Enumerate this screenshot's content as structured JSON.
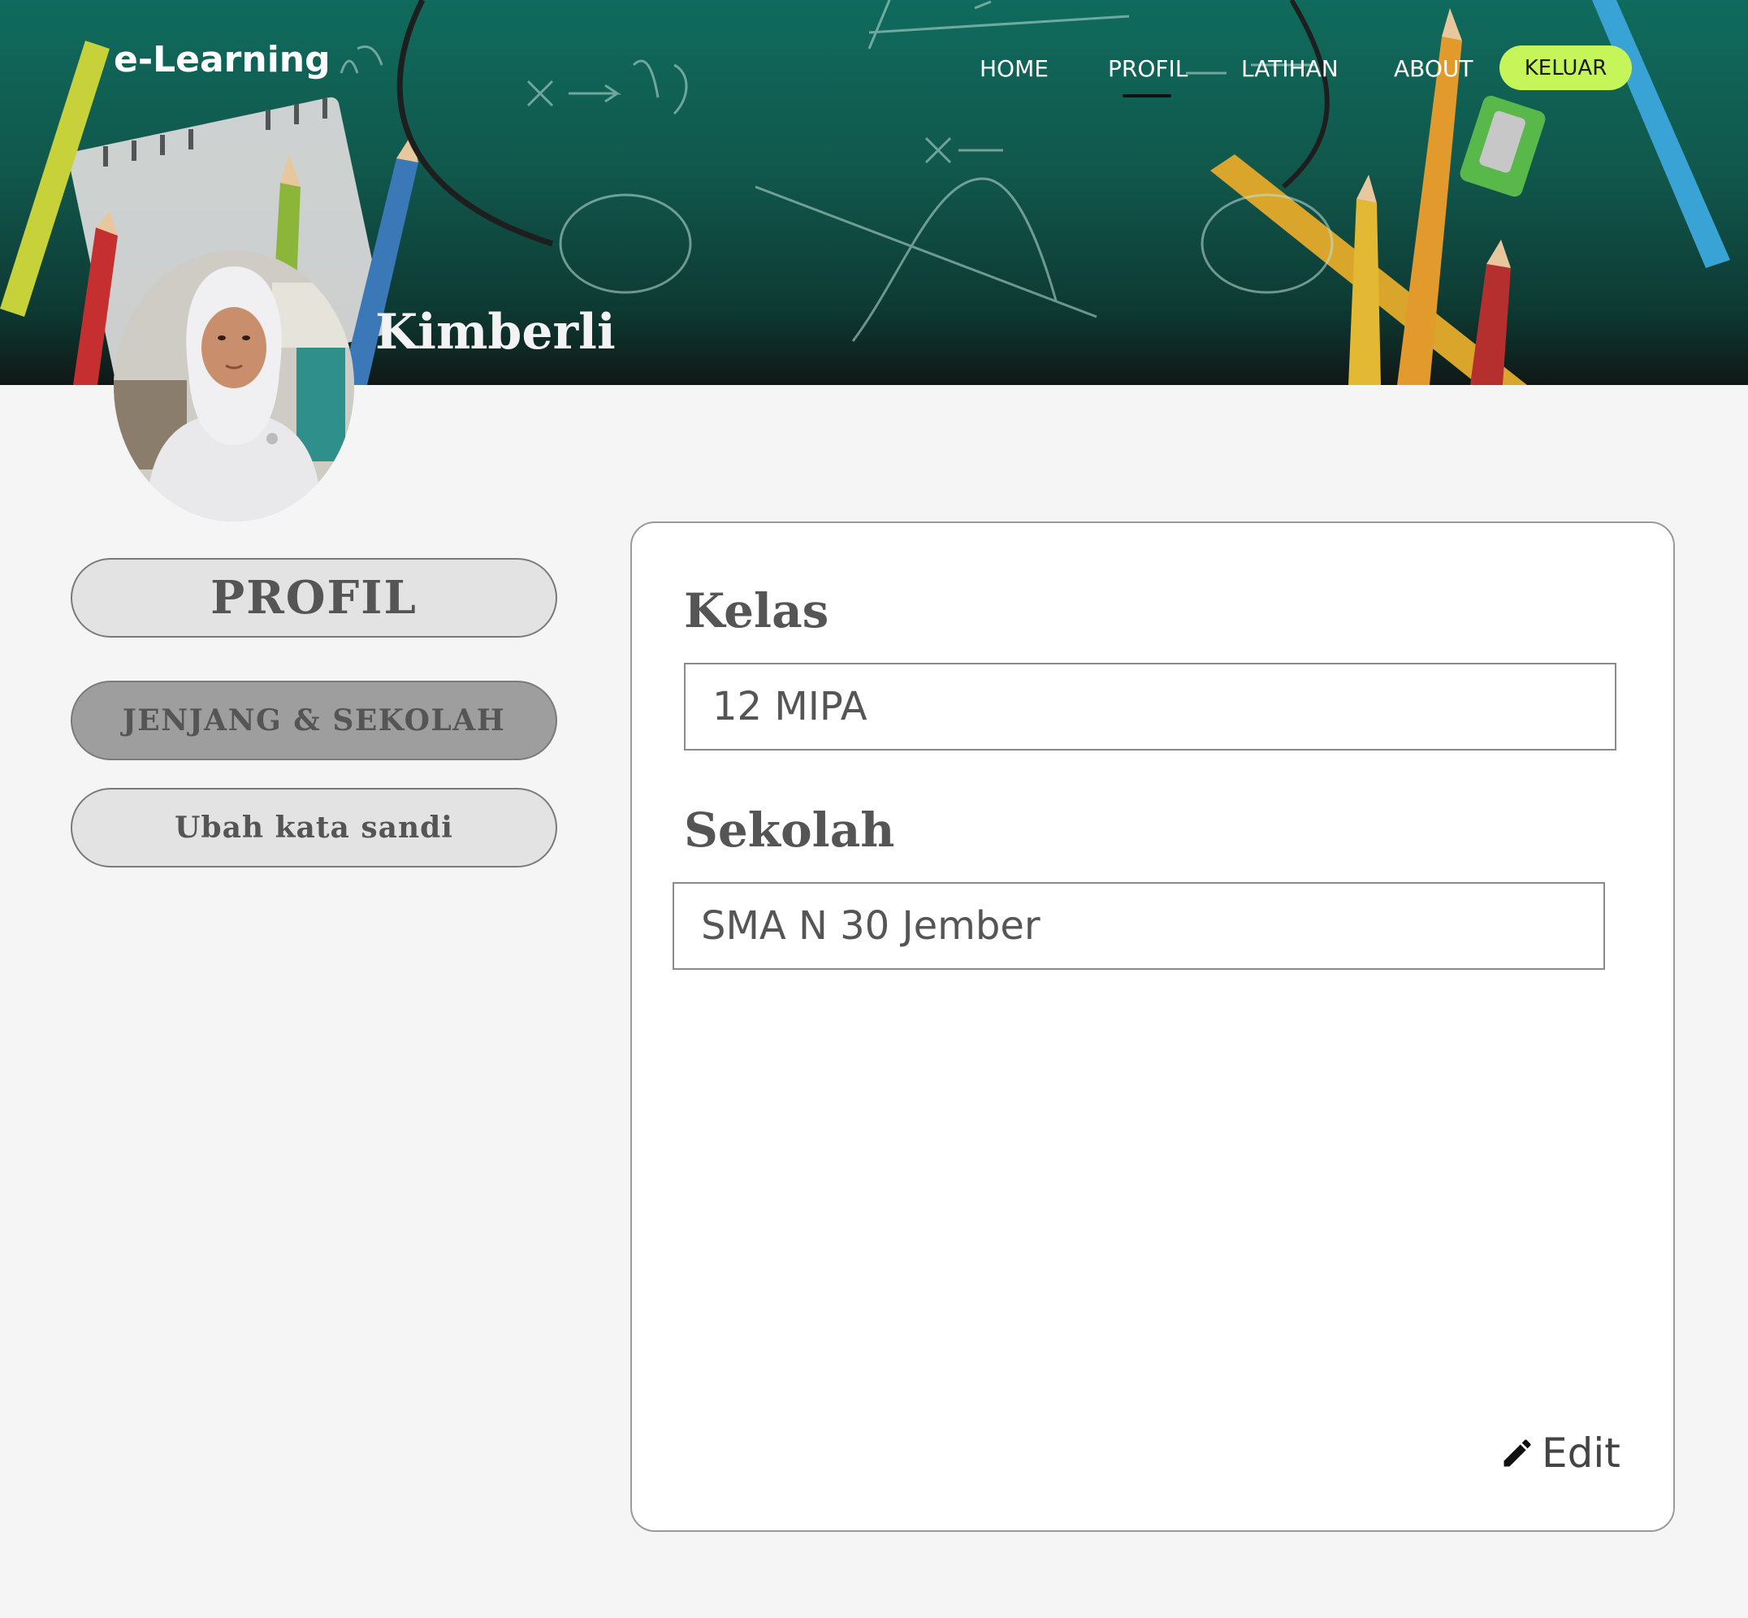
{
  "app": {
    "logo": "e-Learning"
  },
  "nav": {
    "items": [
      {
        "label": "HOME",
        "active": false
      },
      {
        "label": "PROFIL",
        "active": true
      },
      {
        "label": "LATIHAN",
        "active": false
      },
      {
        "label": "ABOUT",
        "active": false
      }
    ],
    "logout_label": "KELUAR"
  },
  "user": {
    "name": "Kimberli"
  },
  "sidebar": {
    "title": "PROFIL",
    "items": [
      {
        "label": "JENJANG & SEKOLAH",
        "selected": true
      },
      {
        "label": "Ubah kata sandi",
        "selected": false
      }
    ]
  },
  "form": {
    "kelas": {
      "label": "Kelas",
      "value": "12 MIPA"
    },
    "sekolah": {
      "label": "Sekolah",
      "value": "SMA N 30 Jember"
    },
    "edit_label": "Edit"
  },
  "colors": {
    "banner": "#0f6b5d",
    "logout_button": "#c6f55a",
    "background": "#f5f5f5",
    "selected_tab": "#9e9e9e"
  },
  "icons": {
    "edit": "pencil-icon",
    "avatar": "user-photo"
  }
}
